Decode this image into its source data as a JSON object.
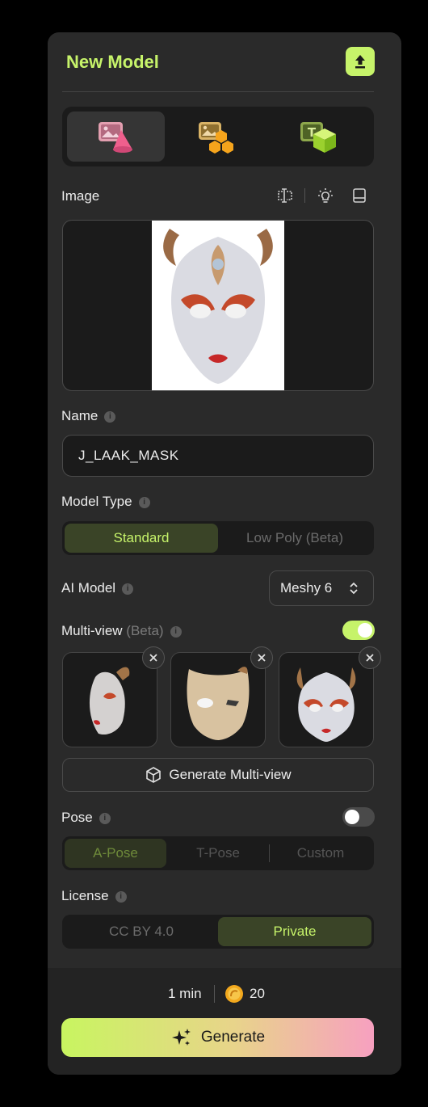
{
  "header": {
    "title": "New Model"
  },
  "mode_tabs": [
    {
      "name": "image-to-3d",
      "active": true
    },
    {
      "name": "multi-image-to-3d",
      "active": false
    },
    {
      "name": "text-to-3d",
      "active": false
    }
  ],
  "image_section": {
    "label": "Image"
  },
  "name_section": {
    "label": "Name",
    "value": "J_LAAK_MASK"
  },
  "model_type": {
    "label": "Model Type",
    "options": [
      "Standard",
      "Low Poly (Beta)"
    ],
    "selected": "Standard"
  },
  "ai_model": {
    "label": "AI Model",
    "value": "Meshy 6"
  },
  "multiview": {
    "label": "Multi-view",
    "beta": "(Beta)",
    "enabled": true,
    "generate_label": "Generate Multi-view"
  },
  "pose": {
    "label": "Pose",
    "enabled": false,
    "options": [
      "A-Pose",
      "T-Pose",
      "Custom"
    ],
    "selected": "A-Pose"
  },
  "license": {
    "label": "License",
    "options": [
      "CC BY 4.0",
      "Private"
    ],
    "selected": "Private"
  },
  "footer": {
    "time": "1 min",
    "credits": "20",
    "generate_label": "Generate"
  },
  "colors": {
    "accent": "#c6f36a",
    "panel": "#2a2a2a",
    "surface": "#1b1b1b"
  }
}
